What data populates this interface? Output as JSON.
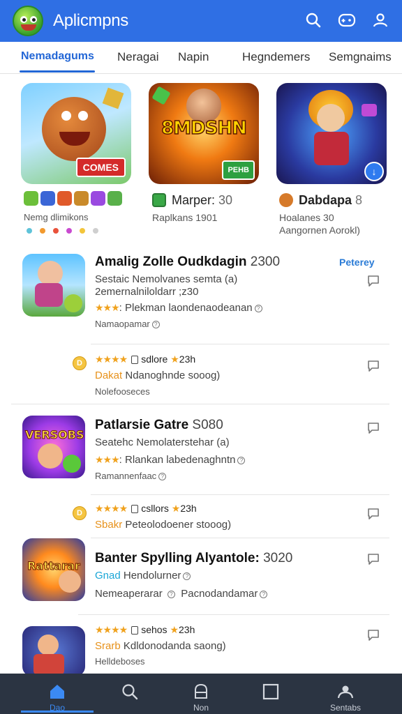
{
  "app": {
    "title": "Aplicmpns"
  },
  "header": {
    "icons": [
      "search-icon",
      "gamepad-icon",
      "user-icon"
    ]
  },
  "tabs": [
    {
      "label": "Nemadagums",
      "active": true
    },
    {
      "label": "Neragai"
    },
    {
      "label": "Napin"
    },
    {
      "label": "Hegndemers"
    },
    {
      "label": "Semgnaims"
    }
  ],
  "featured": [
    {
      "badge": "COMES",
      "name": "Nemg dlimikons"
    },
    {
      "logo": "8MDSHN",
      "tag": "PEHB",
      "name": "Marper:",
      "num": "30",
      "sub": "Raplkans 1901"
    },
    {
      "name": "Dabdapa",
      "num": "8",
      "sub1": "Hoalanes 30",
      "sub2": "Aangornen Aorokl)"
    }
  ],
  "list": {
    "top_link": "Peterey",
    "item1": {
      "title": "Amalig Zolle Oudkdagin",
      "num": "2300",
      "line1": "Sestaic Nemolvanes semta (a)",
      "line2": "2emernalniloldarr ;z30",
      "stars": "★★★",
      "line3": "Plekman laondenaodeanan",
      "line4": "Namaopamar"
    },
    "item1b": {
      "badge": "D",
      "stars": "★★★★",
      "meta": "sdlore",
      "meta_star": "★",
      "meta_num": "23h",
      "orange": "Dakat",
      "text": "Ndanoghnde sooog)",
      "sub": "Nolefooseces"
    },
    "item2": {
      "title": "Patlarsie Gatre",
      "num": "S080",
      "line1": "Seatehc Nemolaterstehar (a)",
      "stars": "★★★",
      "line2": "Rlankan labedenaghntn",
      "line3": "Ramannenfaac"
    },
    "item2b": {
      "badge": "D",
      "stars": "★★★★",
      "meta": "csllors",
      "meta_star": "★",
      "meta_num": "23h",
      "orange": "Sbakr",
      "text": "Peteolodoener stooog)"
    },
    "item3": {
      "title": "Banter Spylling Alyantole:",
      "num": "3020",
      "blue": "Gnad",
      "line1": "Hendolurner",
      "line2": "Nemeaperarar",
      "line2b": "Pacnodandamar",
      "logo": "Rattarar"
    },
    "item3b": {
      "stars": "★★★★",
      "meta": "sehos",
      "meta_star": "★",
      "meta_num": "23h",
      "orange": "Srarb",
      "text": "Kdldonodanda saong)",
      "sub": "Helldeboses"
    }
  },
  "nav": [
    {
      "label": "Dao",
      "icon": "home-icon",
      "active": true
    },
    {
      "label": "",
      "icon": "search-icon"
    },
    {
      "label": "Non",
      "icon": "bag-icon"
    },
    {
      "label": "",
      "icon": "square-icon"
    },
    {
      "label": "Sentabs",
      "icon": "profile-icon"
    }
  ]
}
